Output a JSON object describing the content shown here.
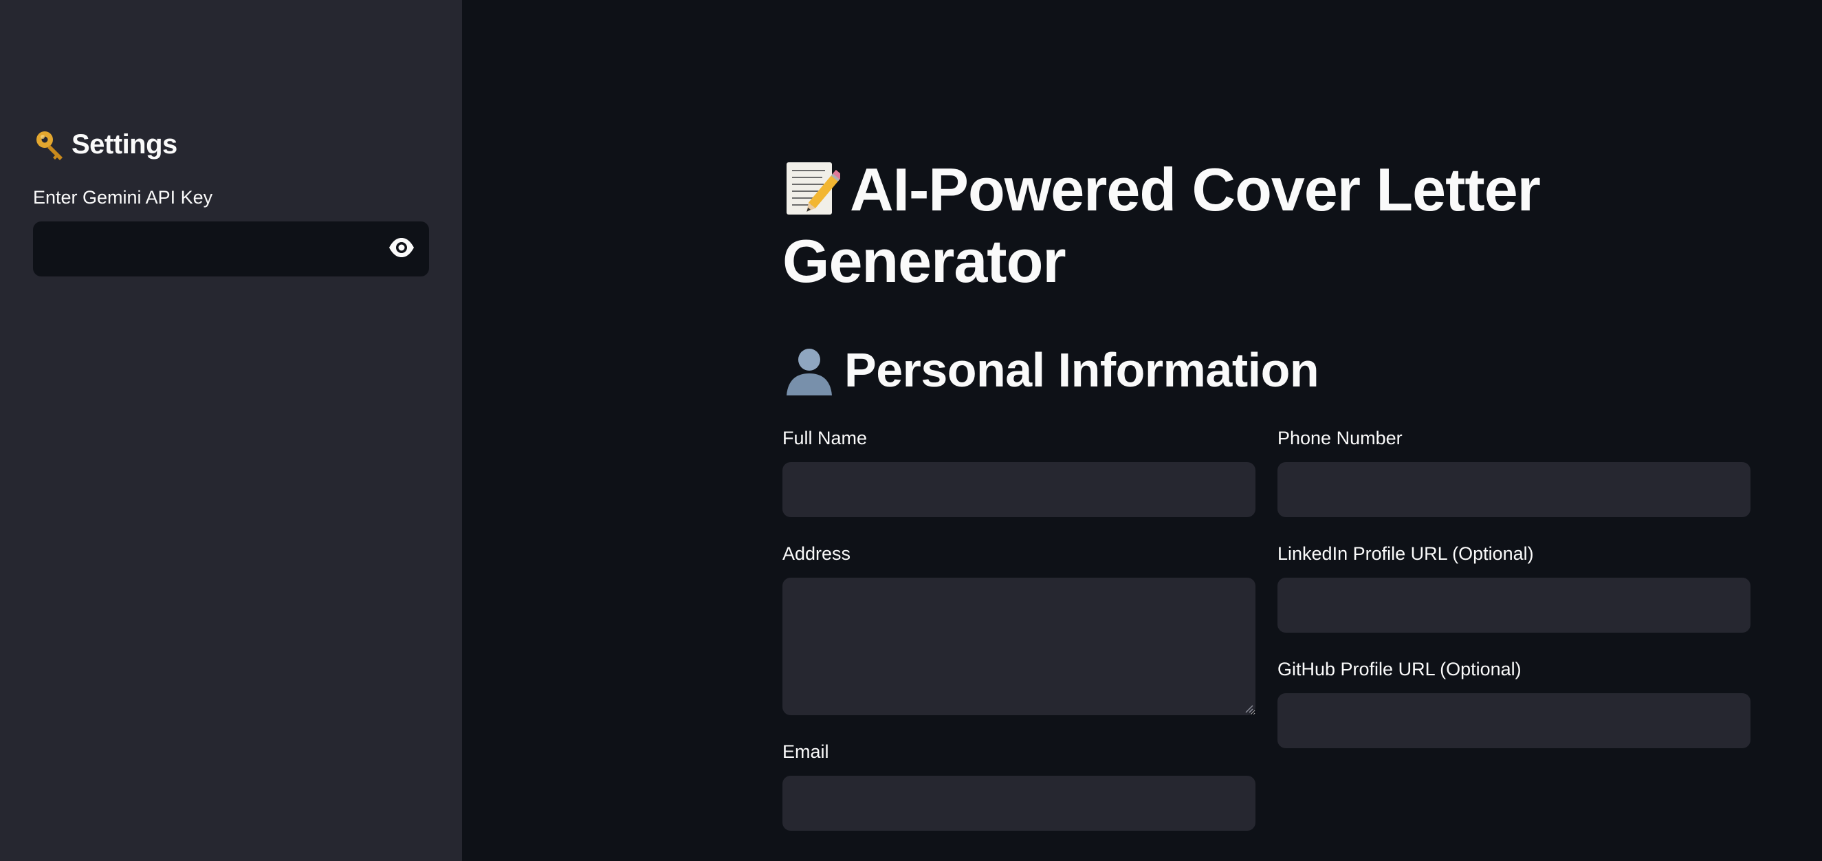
{
  "sidebar": {
    "title": "Settings",
    "title_icon": "key-icon",
    "api_key": {
      "label": "Enter Gemini API Key",
      "value": "",
      "visibility_icon": "eye-icon"
    }
  },
  "main": {
    "title": "AI-Powered Cover Letter Generator",
    "title_icon": "memo-icon",
    "section": {
      "title": "Personal Information",
      "icon": "person-silhouette-icon"
    },
    "fields": {
      "full_name": {
        "label": "Full Name",
        "value": ""
      },
      "phone": {
        "label": "Phone Number",
        "value": ""
      },
      "address": {
        "label": "Address",
        "value": ""
      },
      "linkedin": {
        "label": "LinkedIn Profile URL (Optional)",
        "value": ""
      },
      "github": {
        "label": "GitHub Profile URL (Optional)",
        "value": ""
      },
      "email": {
        "label": "Email",
        "value": ""
      }
    }
  },
  "colors": {
    "background": "#0e1117",
    "sidebar": "#262730",
    "input": "#262730",
    "text": "#fafafa"
  }
}
